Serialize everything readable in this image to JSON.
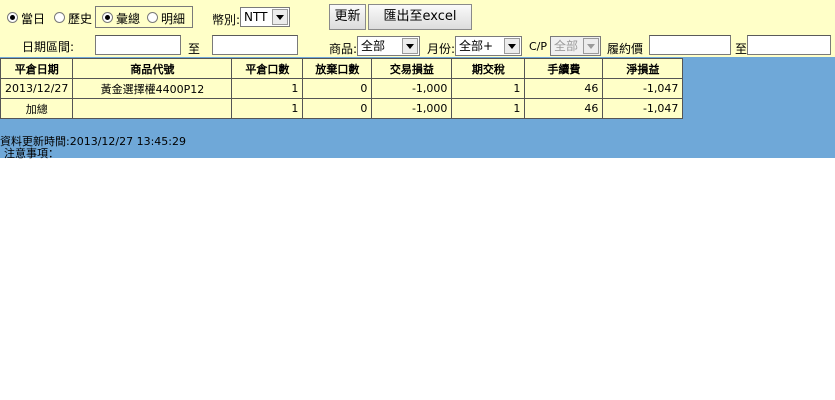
{
  "filters": {
    "radio_today": "當日",
    "radio_history": "歷史",
    "radio_summary": "彙總",
    "radio_detail": "明細",
    "currency_label": "幣別:",
    "currency_value": "NTT",
    "date_range_label": "日期區間:",
    "date_to": "至",
    "product_label": "商品:",
    "product_value": "全部",
    "month_label": "月份:",
    "month_value": "全部+",
    "cp_label": "C/P",
    "cp_value": "全部",
    "strike_label": "履約價",
    "strike_to": "至"
  },
  "buttons": {
    "refresh": "更新",
    "export": "匯出至excel"
  },
  "table": {
    "headers": [
      "平倉日期",
      "商品代號",
      "平倉口數",
      "放棄口數",
      "交易損益",
      "期交稅",
      "手續費",
      "淨損益"
    ],
    "rows": [
      [
        "2013/12/27",
        "黃金選擇權4400P12",
        "1",
        "0",
        "-1,000",
        "1",
        "46",
        "-1,047"
      ],
      [
        "加總",
        "",
        "1",
        "0",
        "-1,000",
        "1",
        "46",
        "-1,047"
      ]
    ]
  },
  "footer": {
    "updated": "資料更新時間:2013/12/27 13:45:29",
    "notes": "注意事項："
  }
}
